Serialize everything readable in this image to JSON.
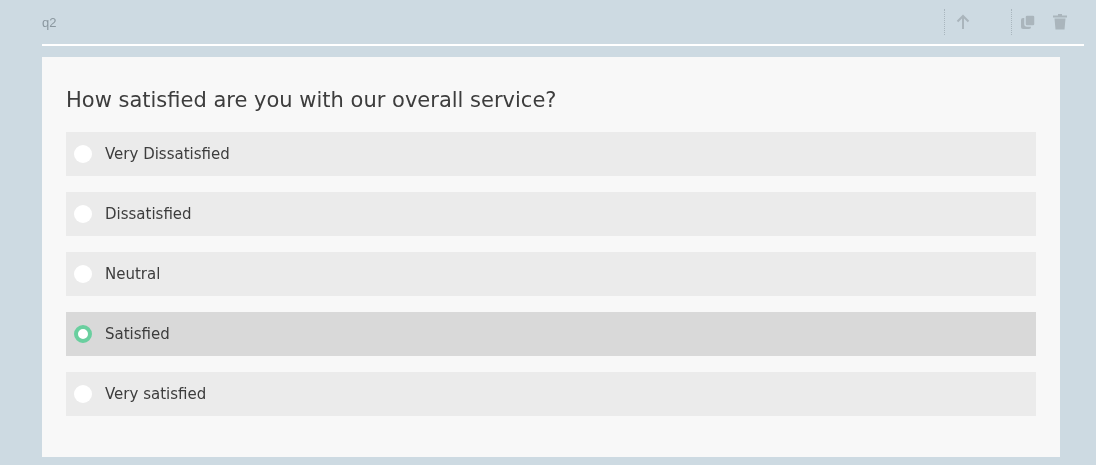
{
  "question_id": "q2",
  "question": {
    "title": "How satisfied are you with our overall service?",
    "options": [
      {
        "label": "Very Dissatisfied",
        "selected": false
      },
      {
        "label": "Dissatisfied",
        "selected": false
      },
      {
        "label": "Neutral",
        "selected": false
      },
      {
        "label": "Satisfied",
        "selected": true
      },
      {
        "label": "Very satisfied",
        "selected": false
      }
    ]
  }
}
